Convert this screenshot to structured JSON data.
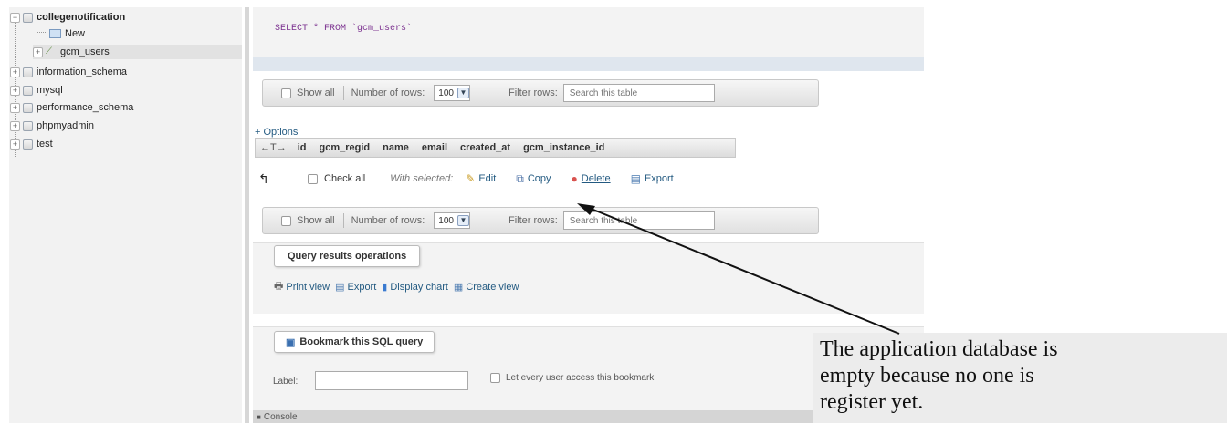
{
  "sidebar": {
    "databases": [
      {
        "name": "collegenotification",
        "expander": "−",
        "tables": [
          {
            "name": "New",
            "icon": "new-table-icon"
          },
          {
            "name": "gcm_users",
            "icon": "table-icon",
            "selected": true
          }
        ]
      },
      {
        "name": "information_schema",
        "expander": "+"
      },
      {
        "name": "mysql",
        "expander": "+"
      },
      {
        "name": "performance_schema",
        "expander": "+"
      },
      {
        "name": "phpmyadmin",
        "expander": "+"
      },
      {
        "name": "test",
        "expander": "+"
      }
    ]
  },
  "query": {
    "sql": "SELECT * FROM `gcm_users`"
  },
  "nav_top": {
    "show_all_label": "Show all",
    "rows_label": "Number of rows:",
    "rows_value": "100",
    "filter_label": "Filter rows:",
    "search_placeholder": "Search this table"
  },
  "nav_bottom": {
    "show_all_label": "Show all",
    "rows_label": "Number of rows:",
    "rows_value": "100",
    "filter_label": "Filter rows:",
    "search_placeholder": "Search this table"
  },
  "results": {
    "options_label": "+ Options",
    "sort_arrows": "←T→",
    "columns": [
      "id",
      "gcm_regid",
      "name",
      "email",
      "created_at",
      "gcm_instance_id"
    ]
  },
  "actions": {
    "check_all": "Check all",
    "with_selected": "With selected:",
    "edit": "Edit",
    "copy": "Copy",
    "delete": "Delete",
    "export": "Export"
  },
  "query_results_operations": {
    "title": "Query results operations",
    "print_view": "Print view",
    "export": "Export",
    "display_chart": "Display chart",
    "create_view": "Create view"
  },
  "bookmark": {
    "title": "Bookmark this SQL query",
    "label_text": "Label:",
    "let_every_user": "Let every user access this bookmark"
  },
  "console": {
    "label": "Console"
  },
  "annotation": {
    "lines": [
      "The application database is",
      "empty because no one is",
      "register yet."
    ]
  },
  "colors": {
    "sql_text": "#7a2f8e",
    "link": "#235a81",
    "delete_icon": "#d9534f"
  }
}
